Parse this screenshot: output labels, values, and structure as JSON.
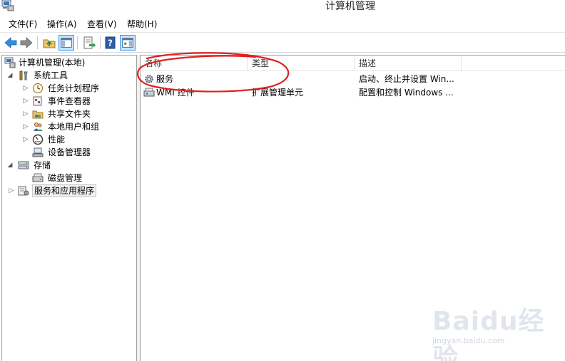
{
  "window": {
    "title": "计算机管理"
  },
  "menu": [
    {
      "label": "文件(F)"
    },
    {
      "label": "操作(A)"
    },
    {
      "label": "查看(V)"
    },
    {
      "label": "帮助(H)"
    }
  ],
  "toolbar": {
    "buttons": [
      {
        "icon": "back-arrow-icon"
      },
      {
        "icon": "forward-arrow-icon"
      },
      {
        "icon": "up-folder-icon"
      },
      {
        "icon": "show-hide-console-tree-icon"
      },
      {
        "icon": "export-list-icon"
      },
      {
        "icon": "help-icon"
      },
      {
        "icon": "show-hide-action-pane-icon"
      }
    ]
  },
  "tree": {
    "root": "计算机管理(本地)",
    "items": [
      {
        "label": "系统工具",
        "icon": "tools-icon",
        "expanded": true
      },
      {
        "label": "任务计划程序",
        "icon": "clock-icon"
      },
      {
        "label": "事件查看器",
        "icon": "event-viewer-icon"
      },
      {
        "label": "共享文件夹",
        "icon": "shared-folder-icon"
      },
      {
        "label": "本地用户和组",
        "icon": "users-icon"
      },
      {
        "label": "性能",
        "icon": "performance-icon"
      },
      {
        "label": "设备管理器",
        "icon": "device-manager-icon"
      },
      {
        "label": "存储",
        "icon": "storage-icon",
        "expanded": true
      },
      {
        "label": "磁盘管理",
        "icon": "disk-icon"
      },
      {
        "label": "服务和应用程序",
        "icon": "services-apps-icon",
        "selected": true
      }
    ]
  },
  "list": {
    "columns": [
      "名称",
      "类型",
      "描述"
    ],
    "rows": [
      {
        "name": "服务",
        "type": "",
        "desc": "启动、终止并设置 Win...",
        "icon": "gear-icon"
      },
      {
        "name": "WMI 控件",
        "type": "扩展管理单元",
        "desc": "配置和控制 Windows ...",
        "icon": "wmi-control-icon"
      }
    ]
  },
  "annotation": {
    "color": "#e0201f",
    "shape": "hand-drawn-ellipse"
  },
  "watermark": {
    "brand": "Baidu经验",
    "url": "jingyan.baidu.com"
  }
}
